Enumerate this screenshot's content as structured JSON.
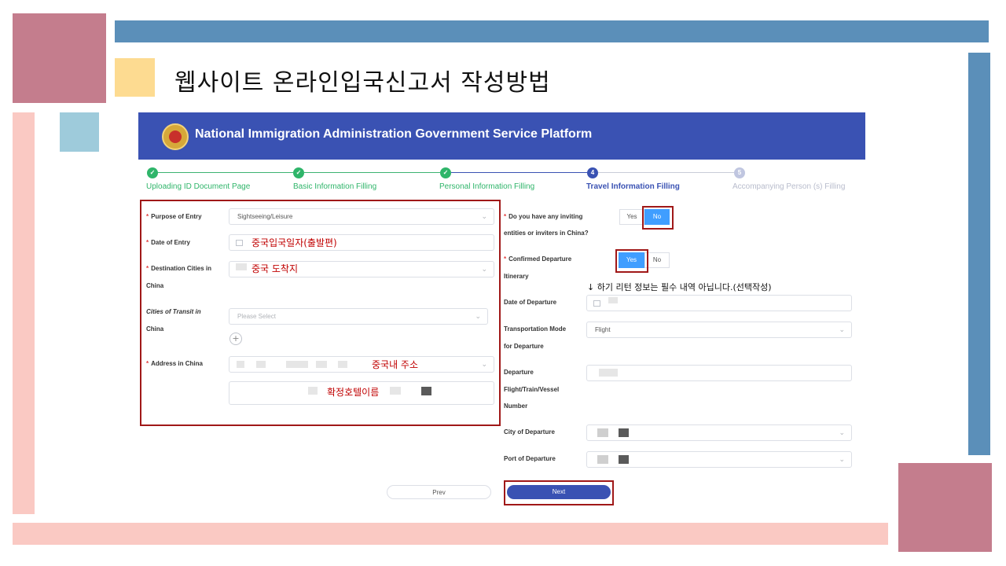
{
  "slide": {
    "title": "웹사이트 온라인입국신고서 작성방법",
    "colors": {
      "rose": "#c47d8d",
      "steel_blue": "#5b8fb9",
      "yellow": "#fddb91",
      "light_blue": "#9ecbdb",
      "pink": "#fac9c3"
    }
  },
  "portal": {
    "header_title": "National Immigration Administration Government Service Platform",
    "emblem_icon": "national-emblem-icon",
    "header_color": "#3a52b3",
    "steps": [
      {
        "label": "Uploading ID Document Page",
        "status": "done"
      },
      {
        "label": "Basic Information Filling",
        "status": "done"
      },
      {
        "label": "Personal Information Filling",
        "status": "done"
      },
      {
        "label": "Travel Information Filling",
        "status": "active",
        "number": "4"
      },
      {
        "label": "Accompanying Person (s) Filling",
        "status": "pending",
        "number": "5"
      }
    ],
    "left": {
      "purpose_label": "Purpose of Entry",
      "purpose_value": "Sightseeing/Leisure",
      "date_label": "Date of Entry",
      "dest_label_1": "Destination Cities in",
      "dest_label_2": "China",
      "transit_label_1": "Cities of Transit in",
      "transit_label_2": "China",
      "transit_placeholder": "Please Select",
      "plus": "+",
      "address_label": "Address in China"
    },
    "right": {
      "inviting_label_1": "Do you have any inviting",
      "inviting_label_2": "entities or inviters in China?",
      "yes": "Yes",
      "no": "No",
      "confirmed_label_1": "Confirmed Departure",
      "confirmed_label_2": "Itinerary",
      "date_dep_label": "Date of Departure",
      "transport_label_1": "Transportation Mode",
      "transport_label_2": "for Departure",
      "transport_value": "Flight",
      "flight_label_1": "Departure",
      "flight_label_2": "Flight/Train/Vessel",
      "flight_label_3": "Number",
      "city_dep_label": "City of Departure",
      "port_dep_label": "Port of Departure"
    },
    "buttons": {
      "prev": "Prev",
      "next": "Next"
    },
    "accent": "#409eff"
  },
  "annotations": {
    "entry_date": "중국입국일자(출발편)",
    "arrival_city": "중국 도착지",
    "address": "중국내 주소",
    "hotel": "확정호텔이름",
    "optional_note": "↓ 하기 리턴 정보는 필수 내역 아닙니다.(선택작성)"
  }
}
